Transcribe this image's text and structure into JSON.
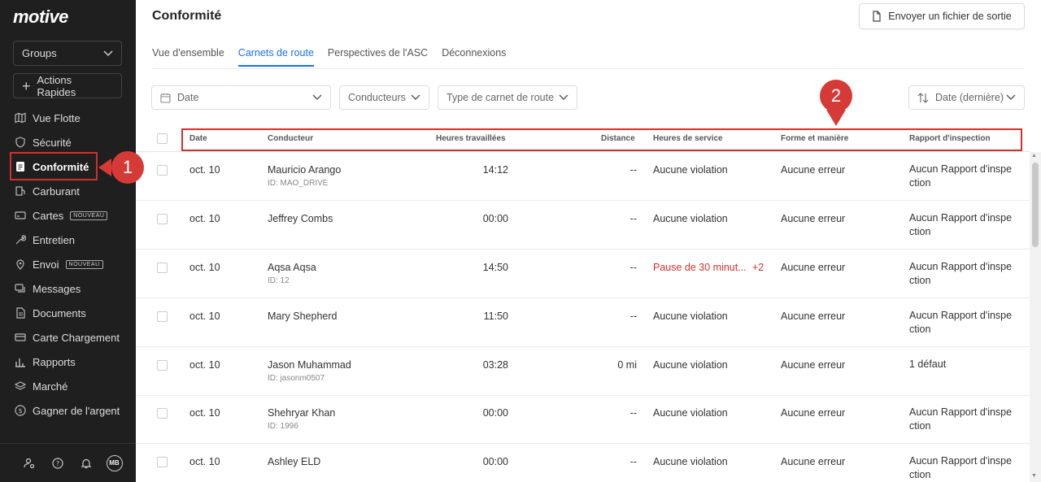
{
  "sidebar": {
    "logo": "motive",
    "groups_label": "Groups",
    "quick_actions_label": "Actions Rapides",
    "items": [
      {
        "label": "Vue Flotte",
        "icon": "map-icon"
      },
      {
        "label": "Sécurité",
        "icon": "shield-icon"
      },
      {
        "label": "Conformité",
        "icon": "document-icon",
        "active": true
      },
      {
        "label": "Carburant",
        "icon": "fuel-icon"
      },
      {
        "label": "Cartes",
        "icon": "card-icon",
        "badge": "NOUVEAU"
      },
      {
        "label": "Entretien",
        "icon": "wrench-icon"
      },
      {
        "label": "Envoi",
        "icon": "pin-icon",
        "badge": "NOUVEAU"
      },
      {
        "label": "Messages",
        "icon": "chat-icon"
      },
      {
        "label": "Documents",
        "icon": "file-icon"
      },
      {
        "label": "Carte Chargement",
        "icon": "card-icon"
      },
      {
        "label": "Rapports",
        "icon": "bar-chart-icon"
      },
      {
        "label": "Marché",
        "icon": "layers-icon"
      },
      {
        "label": "Gagner de l'argent",
        "icon": "dollar-icon"
      }
    ],
    "avatar_initials": "MB"
  },
  "callouts": {
    "one": "1",
    "two": "2"
  },
  "header": {
    "title": "Conformité",
    "export_label": "Envoyer un fichier de sortie"
  },
  "tabs": [
    {
      "label": "Vue d'ensemble"
    },
    {
      "label": "Carnets de route",
      "active": true
    },
    {
      "label": "Perspectives de l'ASC"
    },
    {
      "label": "Déconnexions"
    }
  ],
  "filters": {
    "date": "Date",
    "drivers": "Conducteurs",
    "log_type": "Type de carnet de route",
    "sort": "Date (dernière)"
  },
  "table": {
    "columns": {
      "date": "Date",
      "driver": "Conducteur",
      "hours": "Heures travaillées",
      "distance": "Distance",
      "hos": "Heures de service",
      "form": "Forme et manière",
      "inspection": "Rapport d'inspection"
    },
    "rows": [
      {
        "date": "oct. 10",
        "driver": "Mauricio Arango",
        "id": "ID: MAO_DRIVE",
        "hours": "14:12",
        "distance": "--",
        "hos": "Aucune violation",
        "hos_extra": "",
        "form": "Aucune erreur",
        "inspection": "Aucun Rapport d'inspection"
      },
      {
        "date": "oct. 10",
        "driver": "Jeffrey Combs",
        "id": "",
        "hours": "00:00",
        "distance": "--",
        "hos": "Aucune violation",
        "hos_extra": "",
        "form": "Aucune erreur",
        "inspection": "Aucun Rapport d'inspection"
      },
      {
        "date": "oct. 10",
        "driver": "Aqsa Aqsa",
        "id": "ID: 12",
        "hours": "14:50",
        "distance": "--",
        "hos": "Pause de 30 minut...",
        "hos_extra": "+2",
        "form": "Aucune erreur",
        "inspection": "Aucun Rapport d'inspection"
      },
      {
        "date": "oct. 10",
        "driver": "Mary Shepherd",
        "id": "",
        "hours": "11:50",
        "distance": "--",
        "hos": "Aucune violation",
        "hos_extra": "",
        "form": "Aucune erreur",
        "inspection": "Aucun Rapport d'inspection"
      },
      {
        "date": "oct. 10",
        "driver": "Jason Muhammad",
        "id": "ID: jasonm0507",
        "hours": "03:28",
        "distance": "0 mi",
        "hos": "Aucune violation",
        "hos_extra": "",
        "form": "Aucune erreur",
        "inspection": "1 défaut"
      },
      {
        "date": "oct. 10",
        "driver": "Shehryar Khan",
        "id": "ID: 1996",
        "hours": "00:00",
        "distance": "--",
        "hos": "Aucune violation",
        "hos_extra": "",
        "form": "Aucune erreur",
        "inspection": "Aucun Rapport d'inspection"
      },
      {
        "date": "oct. 10",
        "driver": "Ashley ELD",
        "id": "",
        "hours": "00:00",
        "distance": "--",
        "hos": "Aucune violation",
        "hos_extra": "",
        "form": "Aucune erreur",
        "inspection": "Aucun Rapport d'inspection"
      }
    ]
  }
}
